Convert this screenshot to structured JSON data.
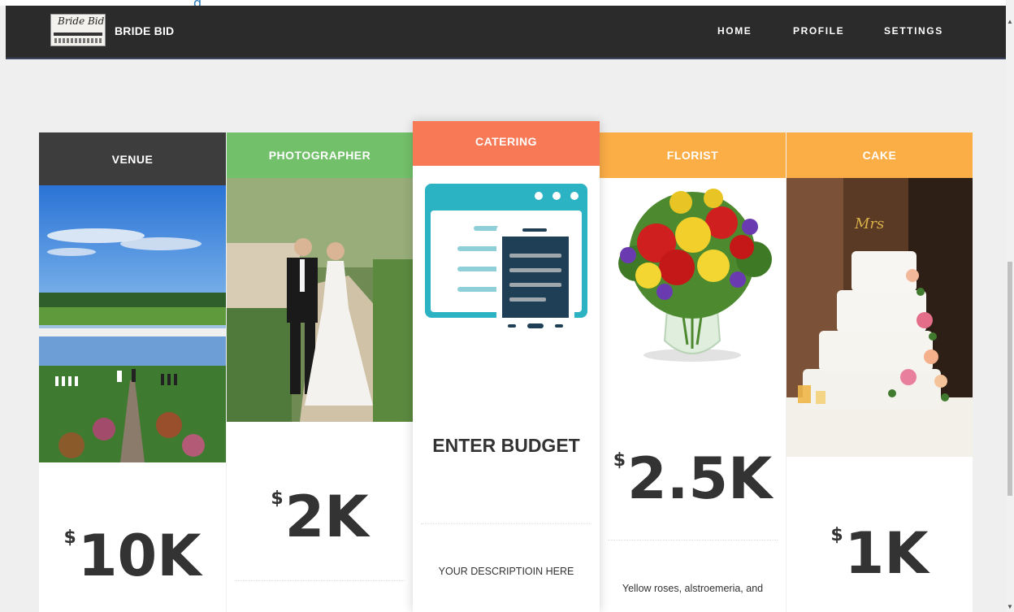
{
  "nav": {
    "brand": "BRIDE BID",
    "logo_text": "Bride Bid",
    "links": [
      "HOME",
      "PROFILE",
      "SETTINGS"
    ],
    "peek_text": "g"
  },
  "cards": {
    "venue": {
      "title": "VENUE",
      "currency": "$",
      "amount": "10K",
      "header_color": "#3d3d3d"
    },
    "photographer": {
      "title": "PHOTOGRAPHER",
      "currency": "$",
      "amount": "2K",
      "header_color": "#72c06a"
    },
    "catering": {
      "title": "CATERING",
      "label": "ENTER BUDGET",
      "description": "YOUR DESCRIPTIOIN HERE",
      "header_color": "#f87956"
    },
    "florist": {
      "title": "FLORIST",
      "currency": "$",
      "amount": "2.5K",
      "description": "Yellow roses, alstroemeria, and",
      "header_color": "#fbad46"
    },
    "cake": {
      "title": "CAKE",
      "currency": "$",
      "amount": "1K",
      "header_color": "#fbad46"
    }
  }
}
